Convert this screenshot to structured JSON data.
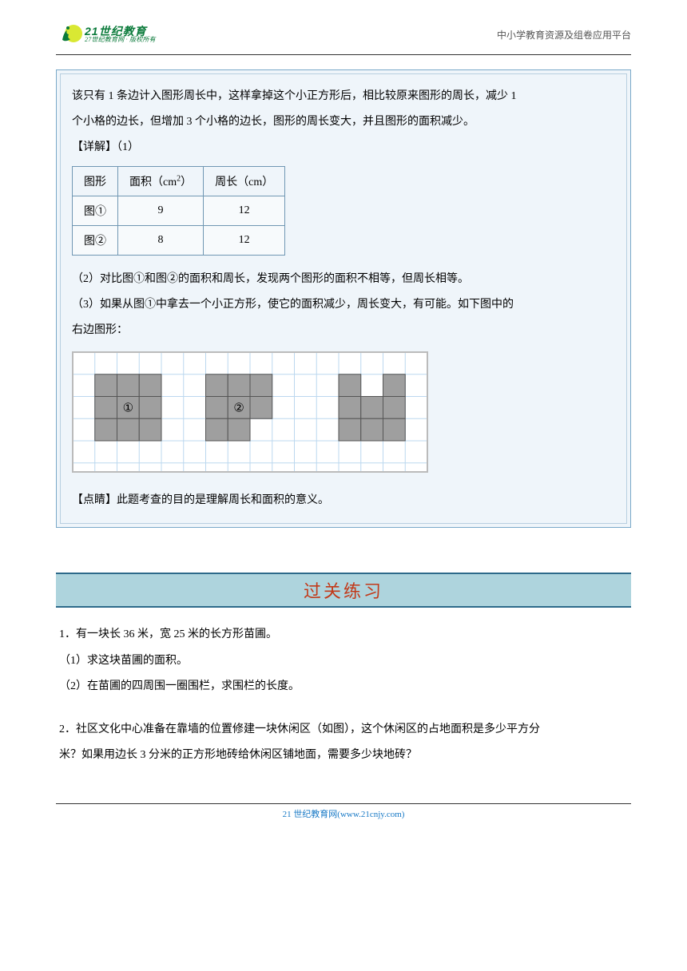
{
  "header": {
    "logo_cn": "21世纪教育",
    "logo_en": "27世纪教育网 · 版权所有",
    "right_text": "中小学教育资源及组卷应用平台"
  },
  "solution": {
    "intro1": "该只有 1 条边计入图形周长中，这样拿掉这个小正方形后，相比较原来图形的周长，减少 1",
    "intro2": "个小格的边长，但增加 3 个小格的边长，图形的周长变大，并且图形的面积减少。",
    "detail_label": "【详解】（1）",
    "table": {
      "headers": [
        "图形",
        "面积（cm²）",
        "周长（cm）"
      ],
      "rows": [
        [
          "图①",
          "9",
          "12"
        ],
        [
          "图②",
          "8",
          "12"
        ]
      ]
    },
    "para2": "（2）对比图①和图②的面积和周长，发现两个图形的面积不相等，但周长相等。",
    "para3a": "（3）如果从图①中拿去一个小正方形，使它的面积减少，周长变大，有可能。如下图中的",
    "para3b": "右边图形：",
    "point_label": "【点睛】此题考查的目的是理解周长和面积的意义。"
  },
  "banner": "过关练习",
  "exercises": {
    "q1_main": "1．有一块长 36 米，宽 25 米的长方形苗圃。",
    "q1_sub1": "（1）求这块苗圃的面积。",
    "q1_sub2": "（2）在苗圃的四周围一圈围栏，求围栏的长度。",
    "q2a": "2．社区文化中心准备在靠墙的位置修建一块休闲区（如图），这个休闲区的占地面积是多少平方分",
    "q2b": "米？如果用边长 3 分米的正方形地砖给休闲区铺地面，需要多少块地砖？"
  },
  "footer": {
    "text": "21 世纪教育网(www.21cnjy.com)"
  },
  "figures": {
    "labels": {
      "one": "①",
      "two": "②"
    },
    "shape1": [
      [
        0,
        0
      ],
      [
        1,
        0
      ],
      [
        2,
        0
      ],
      [
        0,
        1
      ],
      [
        1,
        1
      ],
      [
        2,
        1
      ],
      [
        0,
        2
      ],
      [
        1,
        2
      ],
      [
        2,
        2
      ]
    ],
    "shape2": [
      [
        0,
        0
      ],
      [
        1,
        0
      ],
      [
        2,
        0
      ],
      [
        0,
        1
      ],
      [
        1,
        1
      ],
      [
        2,
        1
      ],
      [
        0,
        2
      ],
      [
        1,
        2
      ]
    ],
    "shape3": [
      [
        0,
        0
      ],
      [
        2,
        0
      ],
      [
        0,
        1
      ],
      [
        1,
        1
      ],
      [
        2,
        1
      ],
      [
        0,
        2
      ],
      [
        1,
        2
      ],
      [
        2,
        2
      ]
    ]
  }
}
